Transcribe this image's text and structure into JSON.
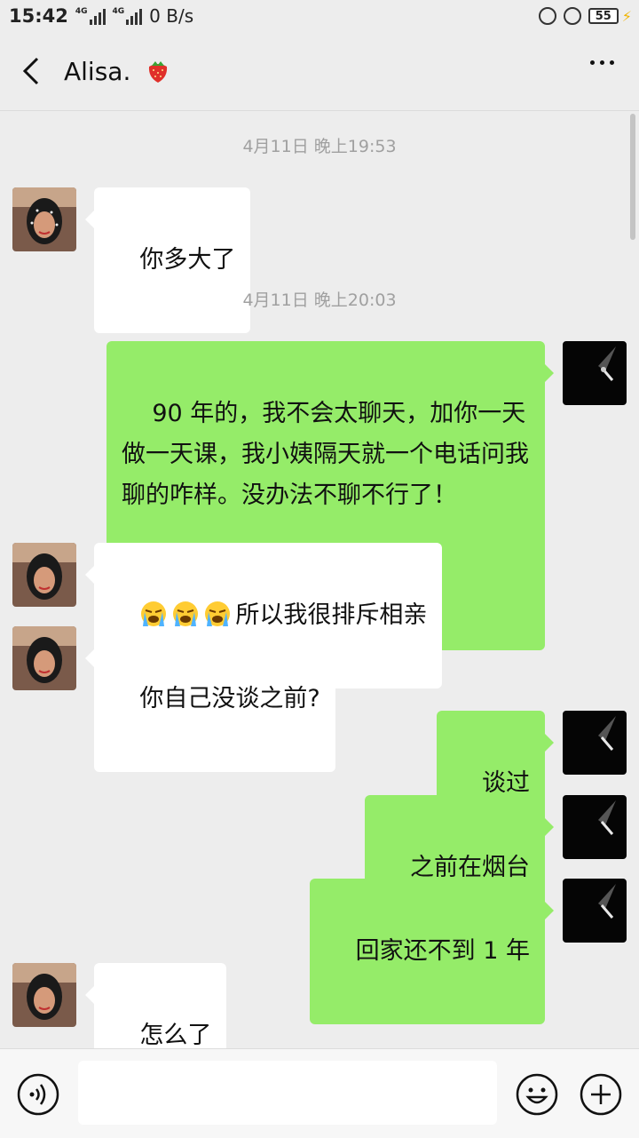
{
  "status_bar": {
    "time": "15:42",
    "signal1_label": "4G",
    "signal2_label": "4G",
    "net_speed": "0 B/s",
    "battery": "55"
  },
  "header": {
    "title": "Alisa.",
    "title_emoji": "strawberry"
  },
  "chat": {
    "timestamps": [
      "4月11日 晚上19:53",
      "4月11日 晚上20:03"
    ],
    "messages": [
      {
        "side": "in",
        "text": "你多大了"
      },
      {
        "side": "out",
        "text": "90 年的，我不会太聊天，加你一天做一天课，我小姨隔天就一个电话问我聊的咋样。没办法不聊不行了！"
      },
      {
        "side": "in",
        "text": "所以我很排斥相亲"
      },
      {
        "side": "in",
        "text": "你自己没谈之前?"
      },
      {
        "side": "out",
        "text": "谈过"
      },
      {
        "side": "out",
        "text": "之前在烟台"
      },
      {
        "side": "out",
        "text": "回家还不到 1 年"
      },
      {
        "side": "in",
        "text": "怎么了"
      }
    ]
  },
  "input_bar": {
    "text": "",
    "icons": [
      "voice-icon",
      "emoji-icon",
      "plus-icon"
    ]
  },
  "colors": {
    "background": "#ededed",
    "outgoing_bubble": "#95ec69",
    "incoming_bubble": "#ffffff",
    "timestamp_text": "#a0a0a0"
  }
}
